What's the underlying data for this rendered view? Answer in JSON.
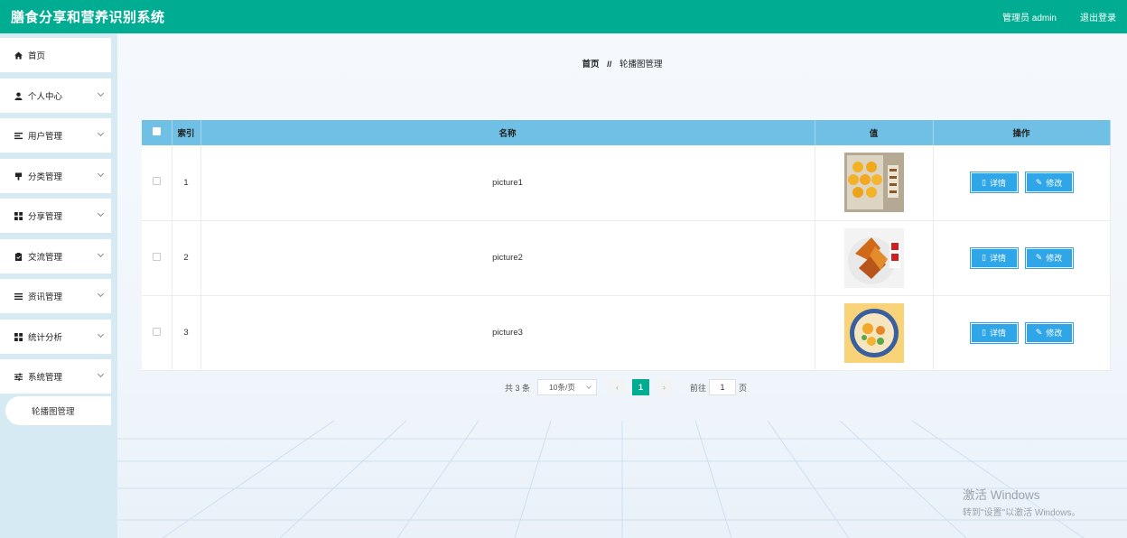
{
  "header": {
    "title": "膳食分享和营养识别系统",
    "user": "管理员 admin",
    "logout": "退出登录"
  },
  "sidebar": {
    "items": [
      {
        "label": "首页",
        "icon": "home-icon"
      },
      {
        "label": "个人中心",
        "icon": "user-icon"
      },
      {
        "label": "用户管理",
        "icon": "list-icon"
      },
      {
        "label": "分类管理",
        "icon": "tag-icon"
      },
      {
        "label": "分享管理",
        "icon": "grid-icon"
      },
      {
        "label": "交流管理",
        "icon": "clipboard-icon"
      },
      {
        "label": "资讯管理",
        "icon": "list-icon"
      },
      {
        "label": "统计分析",
        "icon": "grid-icon"
      },
      {
        "label": "系统管理",
        "icon": "sliders-icon"
      }
    ],
    "active_sub": "轮播图管理"
  },
  "breadcrumb": {
    "home": "首页",
    "sep": "//",
    "current": "轮播图管理"
  },
  "table": {
    "columns": [
      "索引",
      "名称",
      "值",
      "操作"
    ],
    "rows": [
      {
        "index": "1",
        "name": "picture1",
        "thumb_colors": [
          "#b5a993",
          "#f4b12a"
        ]
      },
      {
        "index": "2",
        "name": "picture2",
        "thumb_colors": [
          "#f3f3f3",
          "#d06a1a"
        ]
      },
      {
        "index": "3",
        "name": "picture3",
        "thumb_colors": [
          "#f8d37a",
          "#3a5fa0"
        ]
      }
    ],
    "detail_label": "详情",
    "edit_label": "修改"
  },
  "pagination": {
    "total": "共 3 条",
    "page_size": "10条/页",
    "current_page": "1",
    "goto_label": "前往",
    "goto_value": "1",
    "page_suffix": "页"
  },
  "watermark": {
    "line1": "激活 Windows",
    "line2": "转到\"设置\"以激活 Windows。"
  },
  "colors": {
    "accent": "#00ad92",
    "table_header": "#6fc0e4",
    "button": "#2ea6e8",
    "sidebar_bg": "#d6eaf3"
  }
}
